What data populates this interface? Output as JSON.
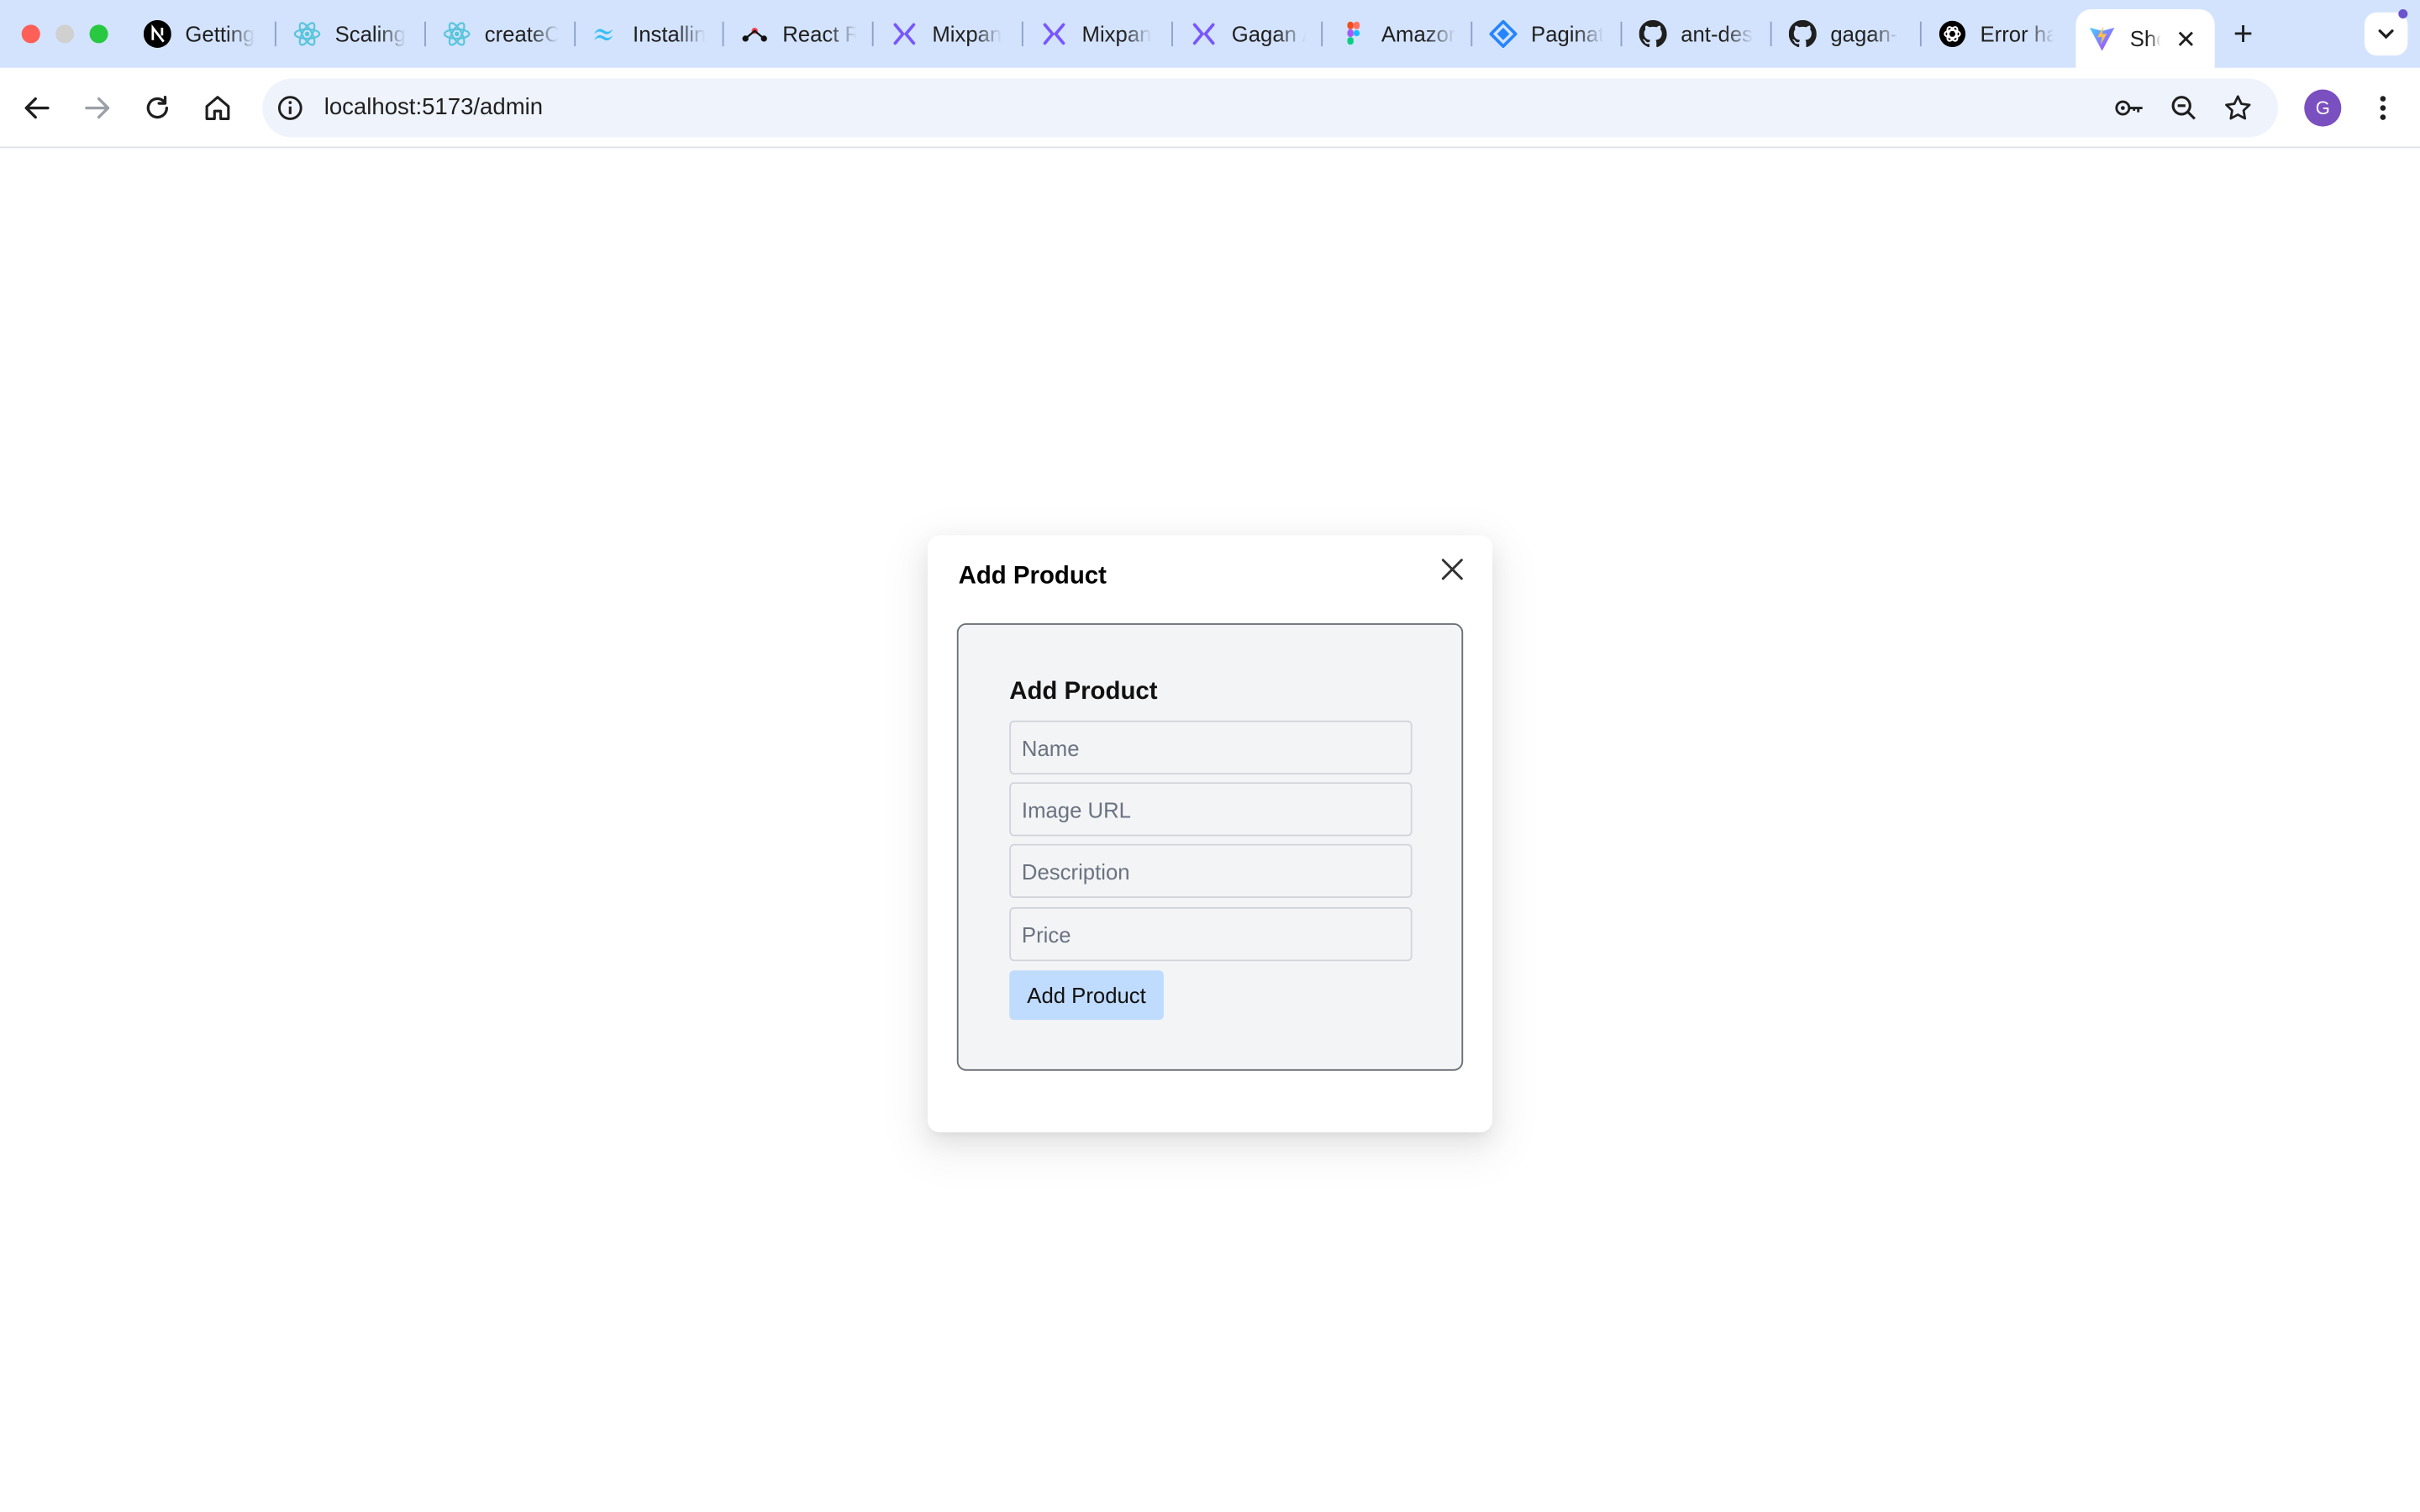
{
  "browser": {
    "tabs": [
      {
        "label": "Getting",
        "icon": "nextjs-icon"
      },
      {
        "label": "Scaling",
        "icon": "react-icon"
      },
      {
        "label": "createC",
        "icon": "react-icon"
      },
      {
        "label": "Installin",
        "icon": "tailwind-icon"
      },
      {
        "label": "React R",
        "icon": "react-router-icon"
      },
      {
        "label": "Mixpan",
        "icon": "mixpanel-icon"
      },
      {
        "label": "Mixpan",
        "icon": "mixpanel-icon"
      },
      {
        "label": "Gagan /",
        "icon": "mixpanel-icon"
      },
      {
        "label": "Amazor",
        "icon": "figma-icon"
      },
      {
        "label": "Paginat",
        "icon": "jira-icon"
      },
      {
        "label": "ant-des",
        "icon": "github-icon"
      },
      {
        "label": "gagan-",
        "icon": "github-icon"
      },
      {
        "label": "Error ha",
        "icon": "openai-icon"
      }
    ],
    "active_tab": {
      "label": "Sho",
      "icon": "vite-icon"
    },
    "url": "localhost:5173/admin",
    "profile_initial": "G",
    "colors": {
      "tabstrip": "#d3e3fd",
      "accent": "#7a4fc0"
    }
  },
  "modal": {
    "title": "Add Product",
    "form": {
      "heading": "Add Product",
      "name_placeholder": "Name",
      "image_placeholder": "Image URL",
      "description_placeholder": "Description",
      "price_placeholder": "Price",
      "submit_label": "Add Product"
    },
    "colors": {
      "button": "#bfdbfe",
      "form_bg": "#f3f4f6"
    }
  }
}
